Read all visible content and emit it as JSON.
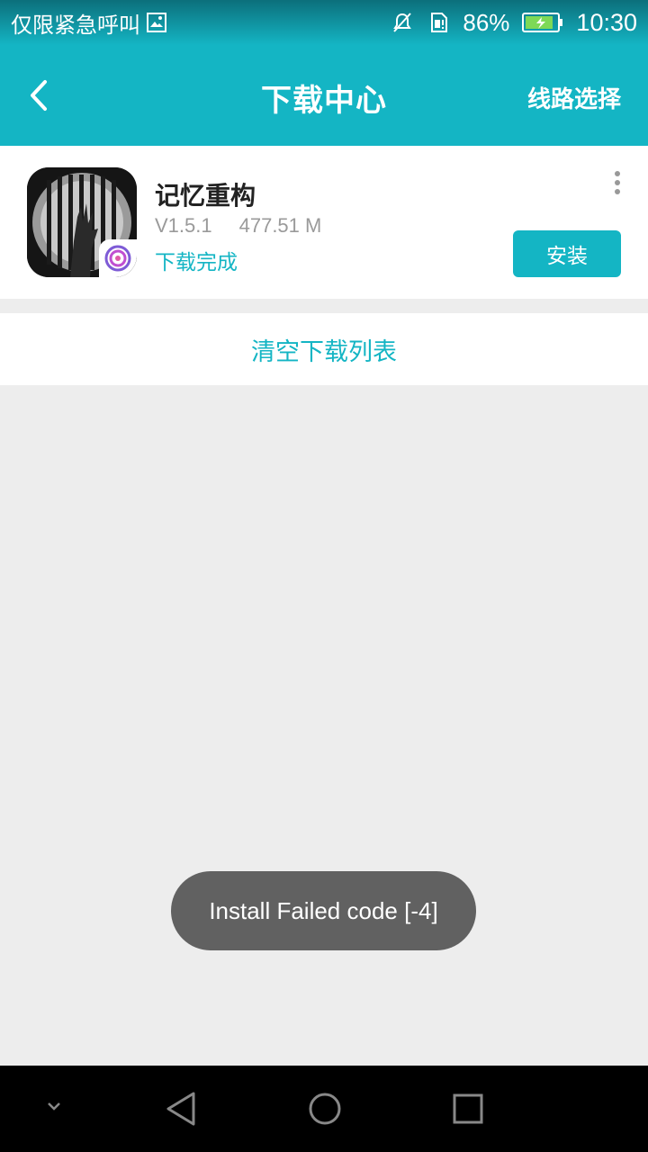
{
  "status_bar": {
    "carrier": "仅限紧急呼叫",
    "battery_percent": "86%",
    "time": "10:30"
  },
  "header": {
    "title": "下载中心",
    "route_select": "线路选择"
  },
  "download_item": {
    "name": "记忆重构",
    "version": "V1.5.1",
    "size": "477.51 M",
    "status": "下载完成",
    "install_label": "安装"
  },
  "clear_list_label": "清空下载列表",
  "toast": "Install Failed code [-4]",
  "colors": {
    "accent": "#14b5c4",
    "background": "#ededed",
    "toast": "#616161"
  }
}
